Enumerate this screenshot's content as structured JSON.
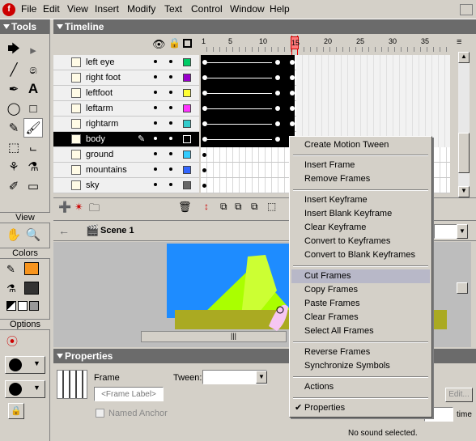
{
  "menubar": {
    "items": [
      "File",
      "Edit",
      "View",
      "Insert",
      "Modify",
      "Text",
      "Control",
      "Window",
      "Help"
    ]
  },
  "tools": {
    "title": "Tools",
    "view_label": "View",
    "colors_label": "Colors",
    "options_label": "Options",
    "stroke_color": "#000000",
    "fill_color_orange": "#f7941d",
    "fill_color_dark": "#333333"
  },
  "timeline": {
    "title": "Timeline",
    "ruler_numbers": [
      "1",
      "5",
      "10",
      "15",
      "20",
      "25",
      "30",
      "35"
    ],
    "current_frame": "15",
    "layers": [
      {
        "name": "left eye",
        "color": "#00cc66"
      },
      {
        "name": "right foot",
        "color": "#9900cc"
      },
      {
        "name": "leftfoot",
        "color": "#ffff33"
      },
      {
        "name": "leftarm",
        "color": "#ff33ff"
      },
      {
        "name": "rightarm",
        "color": "#33cccc"
      },
      {
        "name": "body",
        "color": "#000000"
      },
      {
        "name": "ground",
        "color": "#33ccff"
      },
      {
        "name": "mountains",
        "color": "#3366ff"
      },
      {
        "name": "sky",
        "color": "#666666"
      }
    ]
  },
  "scene": {
    "label": "Scene 1"
  },
  "properties": {
    "title": "Properties",
    "frame_label": "Frame",
    "frame_label_placeholder": "<Frame Label>",
    "tween_label": "Tween:",
    "named_anchor_label": "Named Anchor",
    "status_text": "No sound selected.",
    "edit_label": "Edit...",
    "time_label": "time"
  },
  "context_menu": {
    "items": [
      {
        "label": "Create Motion Tween"
      },
      {
        "label": "Insert Frame"
      },
      {
        "label": "Remove Frames"
      },
      {
        "label": "Insert Keyframe"
      },
      {
        "label": "Insert Blank Keyframe"
      },
      {
        "label": "Clear Keyframe"
      },
      {
        "label": "Convert to Keyframes"
      },
      {
        "label": "Convert to Blank Keyframes"
      },
      {
        "label": "Cut Frames"
      },
      {
        "label": "Copy Frames"
      },
      {
        "label": "Paste Frames"
      },
      {
        "label": "Clear Frames"
      },
      {
        "label": "Select All Frames"
      },
      {
        "label": "Reverse Frames"
      },
      {
        "label": "Synchronize Symbols"
      },
      {
        "label": "Actions"
      },
      {
        "label": "Properties",
        "checked": true
      }
    ],
    "highlighted": "Cut Frames"
  }
}
